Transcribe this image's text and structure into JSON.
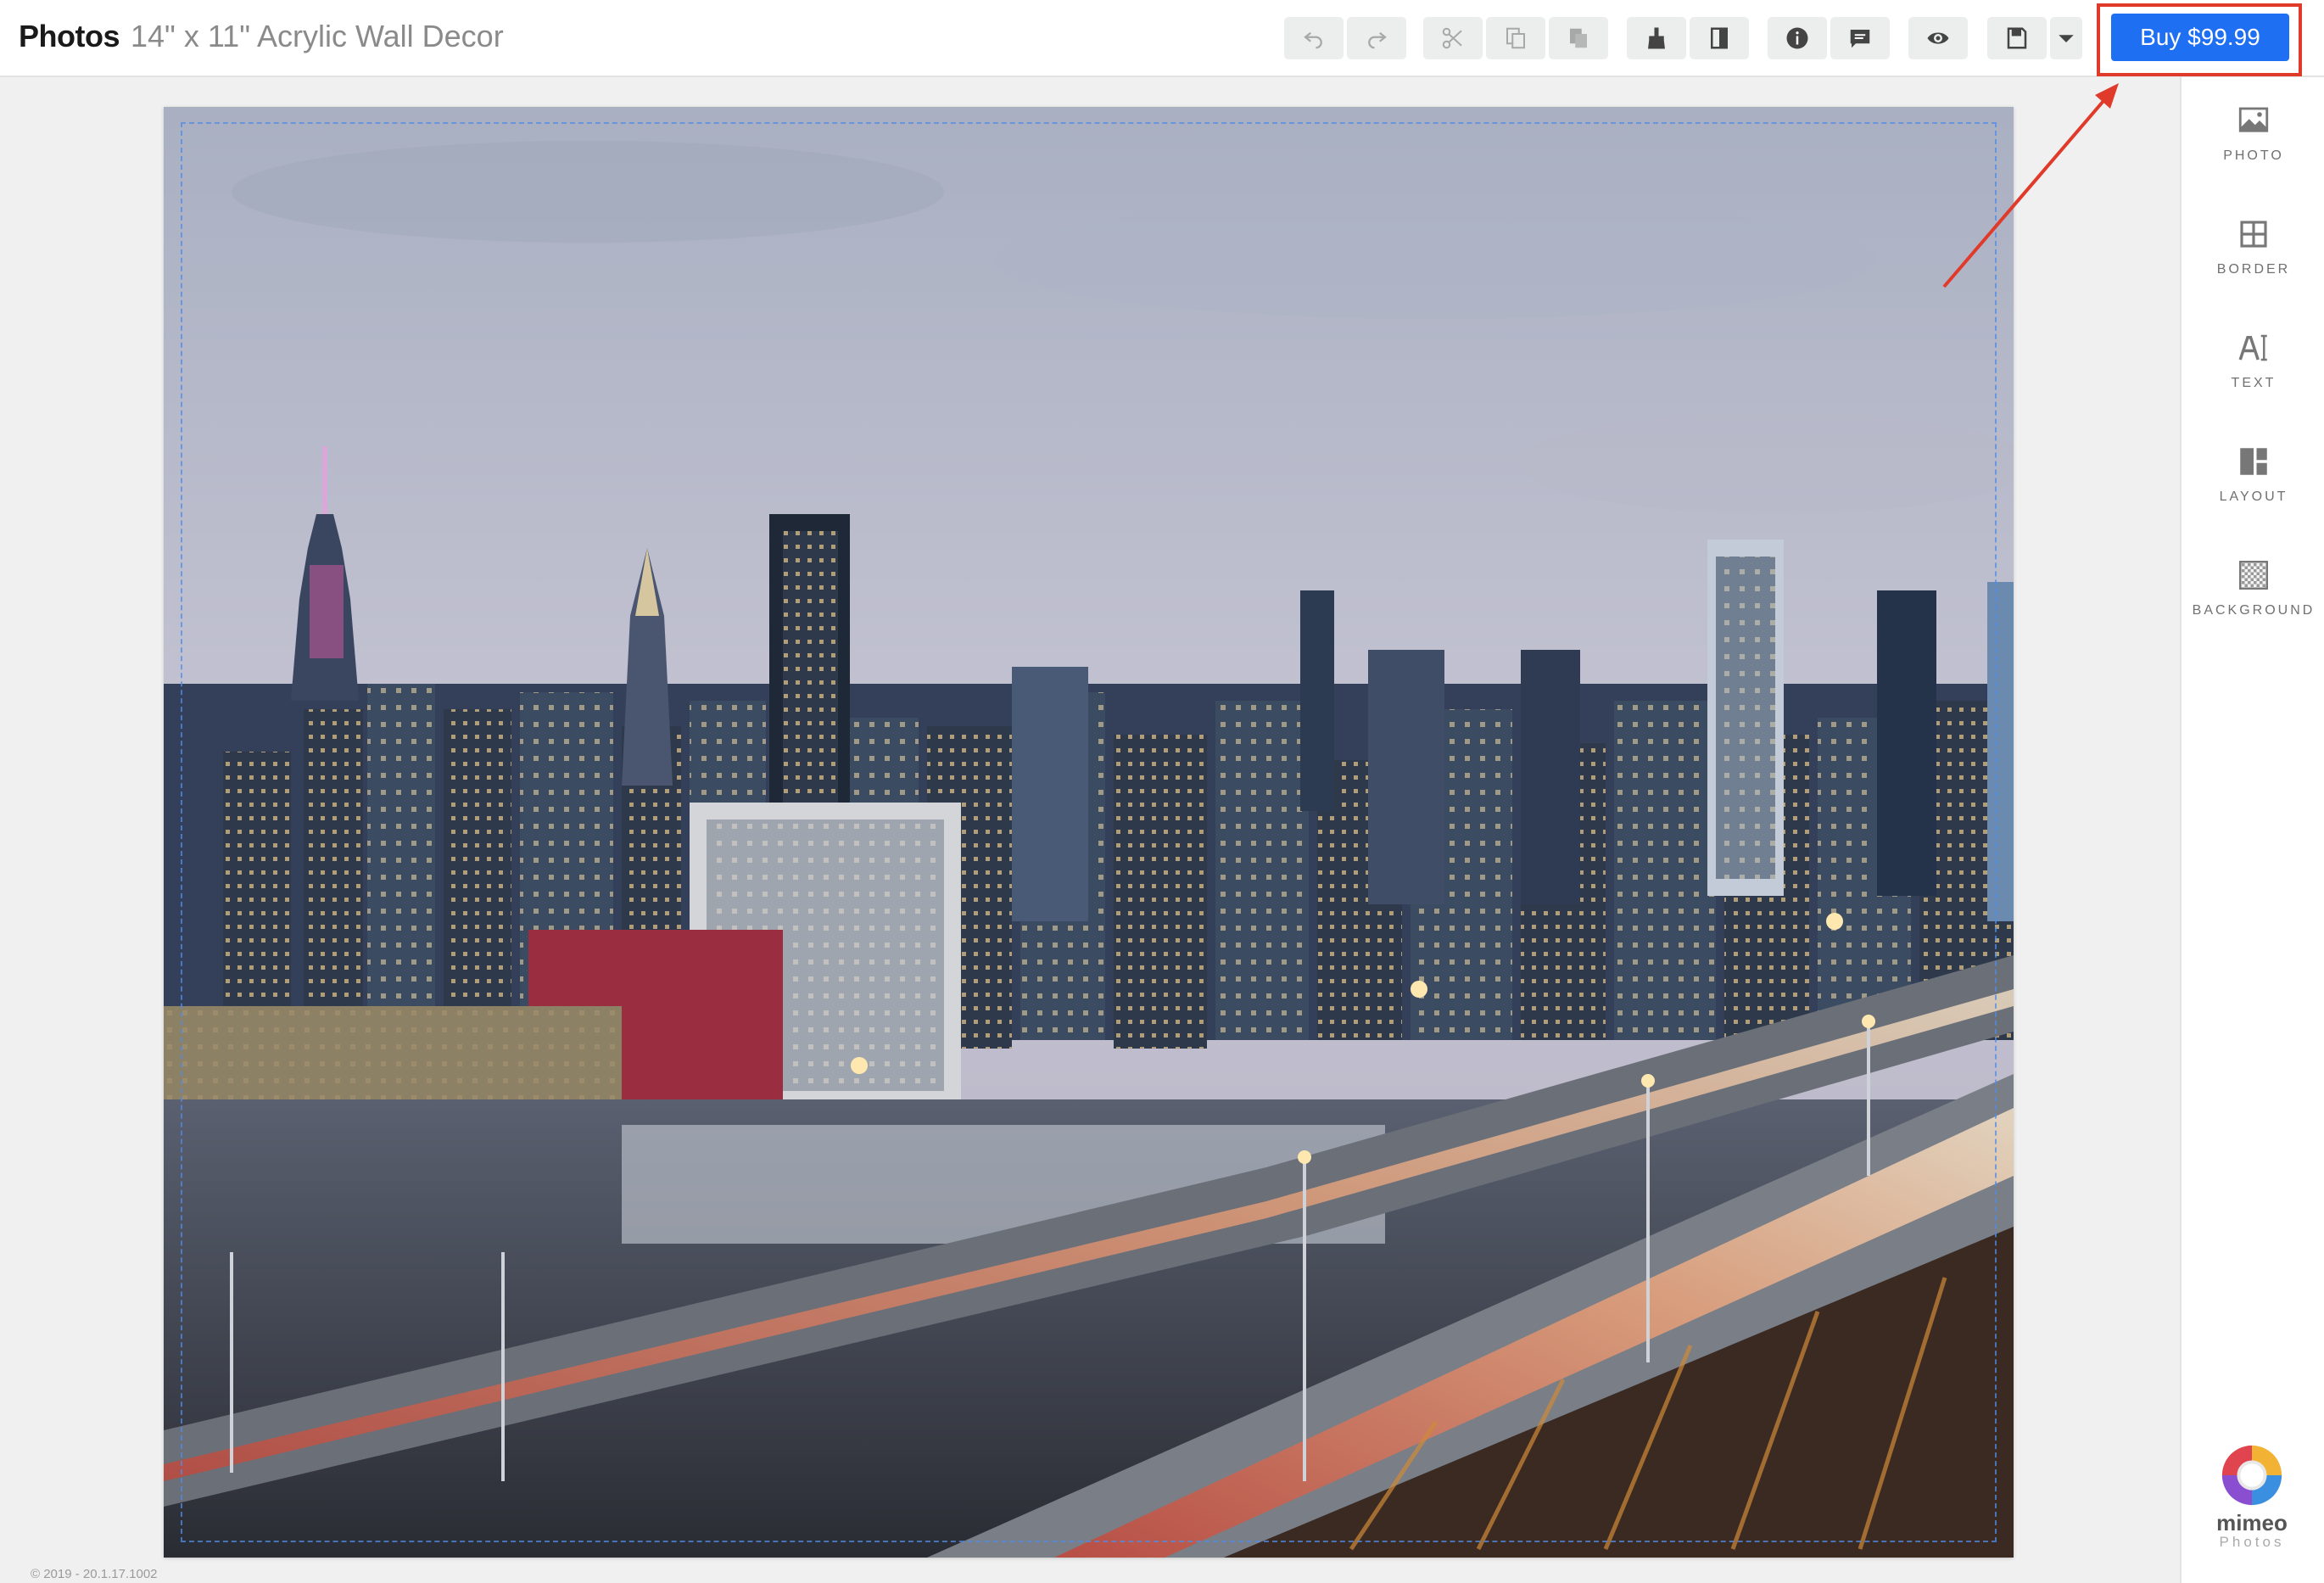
{
  "header": {
    "app_title": "Photos",
    "document_title": "14\" x 11\" Acrylic Wall Decor",
    "buy_label": "Buy $99.99"
  },
  "toolbar": {
    "groups": [
      [
        "undo-icon",
        "redo-icon"
      ],
      [
        "cut-icon",
        "copy-icon",
        "paste-icon"
      ],
      [
        "clean-brush-icon",
        "split-view-icon"
      ],
      [
        "info-icon",
        "comment-icon"
      ],
      [
        "eye-icon"
      ],
      [
        "save-icon",
        "chevron-down-icon"
      ]
    ]
  },
  "side_panel": {
    "items": [
      {
        "label": "PHOTO",
        "icon": "image-icon"
      },
      {
        "label": "BORDER",
        "icon": "border-grid-icon"
      },
      {
        "label": "TEXT",
        "icon": "text-cursor-icon"
      },
      {
        "label": "LAYOUT",
        "icon": "layout-icon"
      },
      {
        "label": "BACKGROUND",
        "icon": "background-pattern-icon"
      }
    ]
  },
  "brand": {
    "name": "mimeo",
    "sub": "Photos"
  },
  "footer": {
    "version": "© 2019 - 20.1.17.1002"
  },
  "colors": {
    "buy_button": "#1f6ff2",
    "highlight": "#e03a2a",
    "sky": "#b9bccb",
    "city": "#2b3442"
  }
}
